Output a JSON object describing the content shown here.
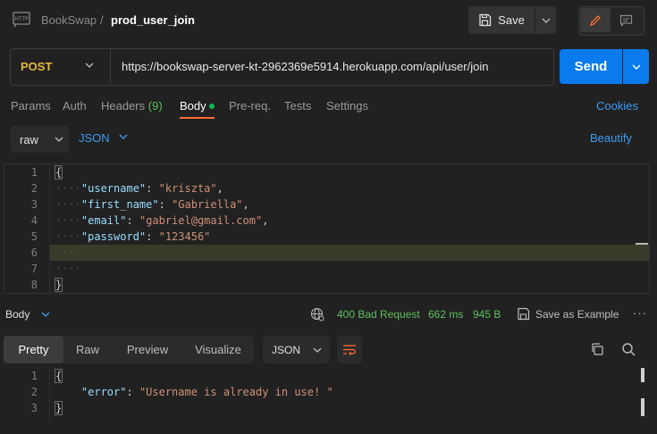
{
  "header": {
    "icon": "http-icon",
    "collection": "BookSwap",
    "separator": "/",
    "request_name": "prod_user_join",
    "save_label": "Save"
  },
  "request": {
    "method": "POST",
    "url": "https://bookswap-server-kt-2962369e5914.herokuapp.com/api/user/join",
    "send_label": "Send"
  },
  "tabs": [
    {
      "label": "Params"
    },
    {
      "label": "Auth"
    },
    {
      "label": "Headers",
      "count": "(9)"
    },
    {
      "label": "Body"
    },
    {
      "label": "Pre-req."
    },
    {
      "label": "Tests"
    },
    {
      "label": "Settings"
    }
  ],
  "active_tab": "Body",
  "cookies_label": "Cookies",
  "body_options": {
    "mode": "raw",
    "language": "JSON",
    "beautify_label": "Beautify"
  },
  "request_body": {
    "line_numbers": [
      "1",
      "2",
      "3",
      "4",
      "5",
      "6",
      "7",
      "8"
    ],
    "open_brace": "{",
    "close_brace": "}",
    "fields": [
      {
        "key": "\"username\"",
        "value": "\"kriszta\"",
        "trail": ","
      },
      {
        "key": "\"first_name\"",
        "value": "\"Gabriella\"",
        "trail": ","
      },
      {
        "key": "\"email\"",
        "value": "\"gabriel@gmail.com\"",
        "trail": ","
      },
      {
        "key": "\"password\"",
        "value": "\"123456\"",
        "trail": ""
      }
    ]
  },
  "response": {
    "section_label": "Body",
    "status": "400 Bad Request",
    "time": "662 ms",
    "size": "945 B",
    "save_example_label": "Save as Example",
    "more": "···",
    "tabs": [
      "Pretty",
      "Raw",
      "Preview",
      "Visualize"
    ],
    "active_tab": "Pretty",
    "format": "JSON",
    "line_numbers": [
      "1",
      "2",
      "3"
    ],
    "open_brace": "{",
    "close_brace": "}",
    "error_key": "\"error\"",
    "error_value": "\"Username is already in use! \""
  },
  "colors": {
    "background": "#212121",
    "accent_blue": "#097bed",
    "method_post": "#e2b93b",
    "status_ok_text": "#5fbf5f",
    "tab_underline": "#ff6c37",
    "body_dot": "#0cbb52"
  }
}
